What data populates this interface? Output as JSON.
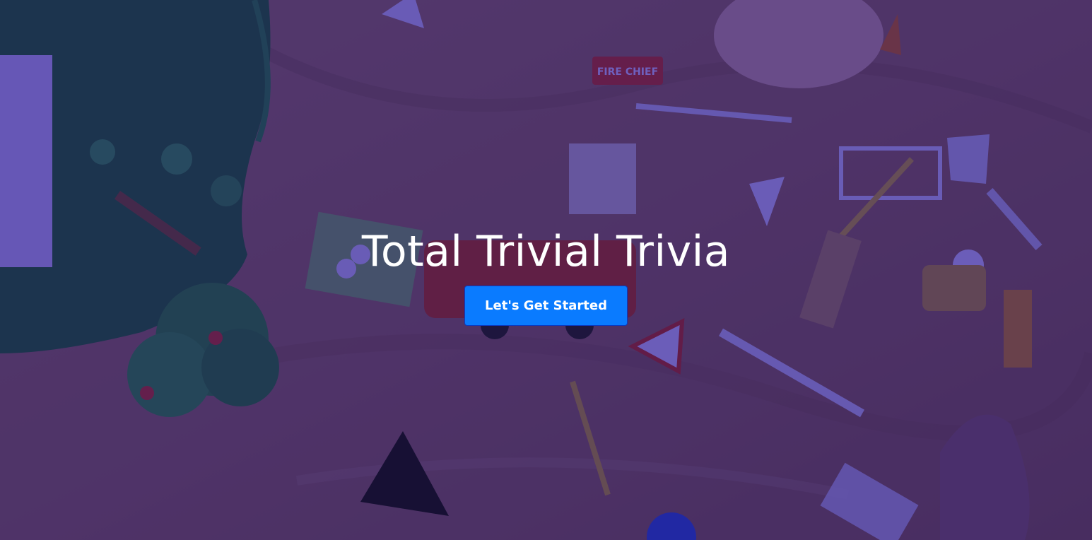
{
  "hero": {
    "title": "Total Trivial Trivia",
    "cta_label": "Let's Get Started",
    "background_image": "playmobil-toys-on-leather",
    "sign_text": "FIRE CHIEF"
  },
  "colors": {
    "overlay": "#2814aa",
    "button": "#0a7bff",
    "title_text": "#ffffff"
  }
}
